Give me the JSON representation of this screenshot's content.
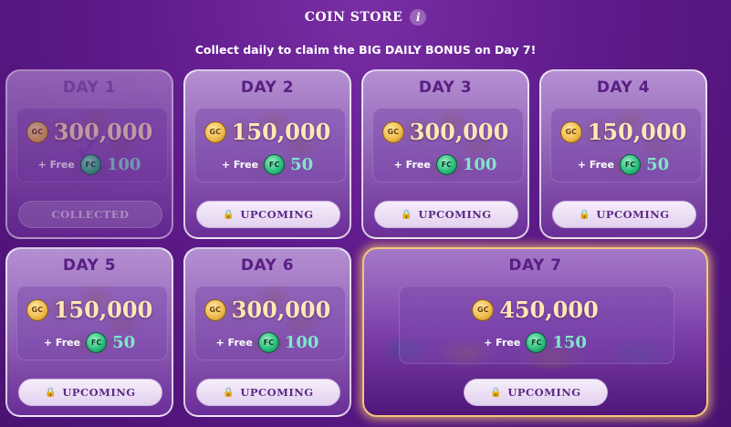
{
  "header": {
    "title": "COIN STORE",
    "info_glyph": "i"
  },
  "subtitle": "Collect daily to claim the BIG DAILY BONUS on Day 7!",
  "icons": {
    "gc_label": "GC",
    "fc_label": "FC",
    "lock": "🔒",
    "check": "✓"
  },
  "free_label": "+ Free",
  "colors": {
    "background": "#5e1a8a",
    "card": "#9567b9",
    "day_label": "#5a1e84",
    "gold_text": "#ffe8b4",
    "fc_text": "#7fe6c8",
    "highlight": "#f3c77a"
  },
  "days": [
    {
      "day": "DAY 1",
      "gc": "300,000",
      "fc": "100",
      "button": "COLLECTED",
      "status": "collected"
    },
    {
      "day": "DAY 2",
      "gc": "150,000",
      "fc": "50",
      "button": "UPCOMING",
      "status": "upcoming"
    },
    {
      "day": "DAY 3",
      "gc": "300,000",
      "fc": "100",
      "button": "UPCOMING",
      "status": "upcoming"
    },
    {
      "day": "DAY 4",
      "gc": "150,000",
      "fc": "50",
      "button": "UPCOMING",
      "status": "upcoming"
    },
    {
      "day": "DAY 5",
      "gc": "150,000",
      "fc": "50",
      "button": "UPCOMING",
      "status": "upcoming"
    },
    {
      "day": "DAY 6",
      "gc": "300,000",
      "fc": "100",
      "button": "UPCOMING",
      "status": "upcoming"
    },
    {
      "day": "DAY 7",
      "gc": "450,000",
      "fc": "150",
      "button": "UPCOMING",
      "status": "upcoming"
    }
  ]
}
